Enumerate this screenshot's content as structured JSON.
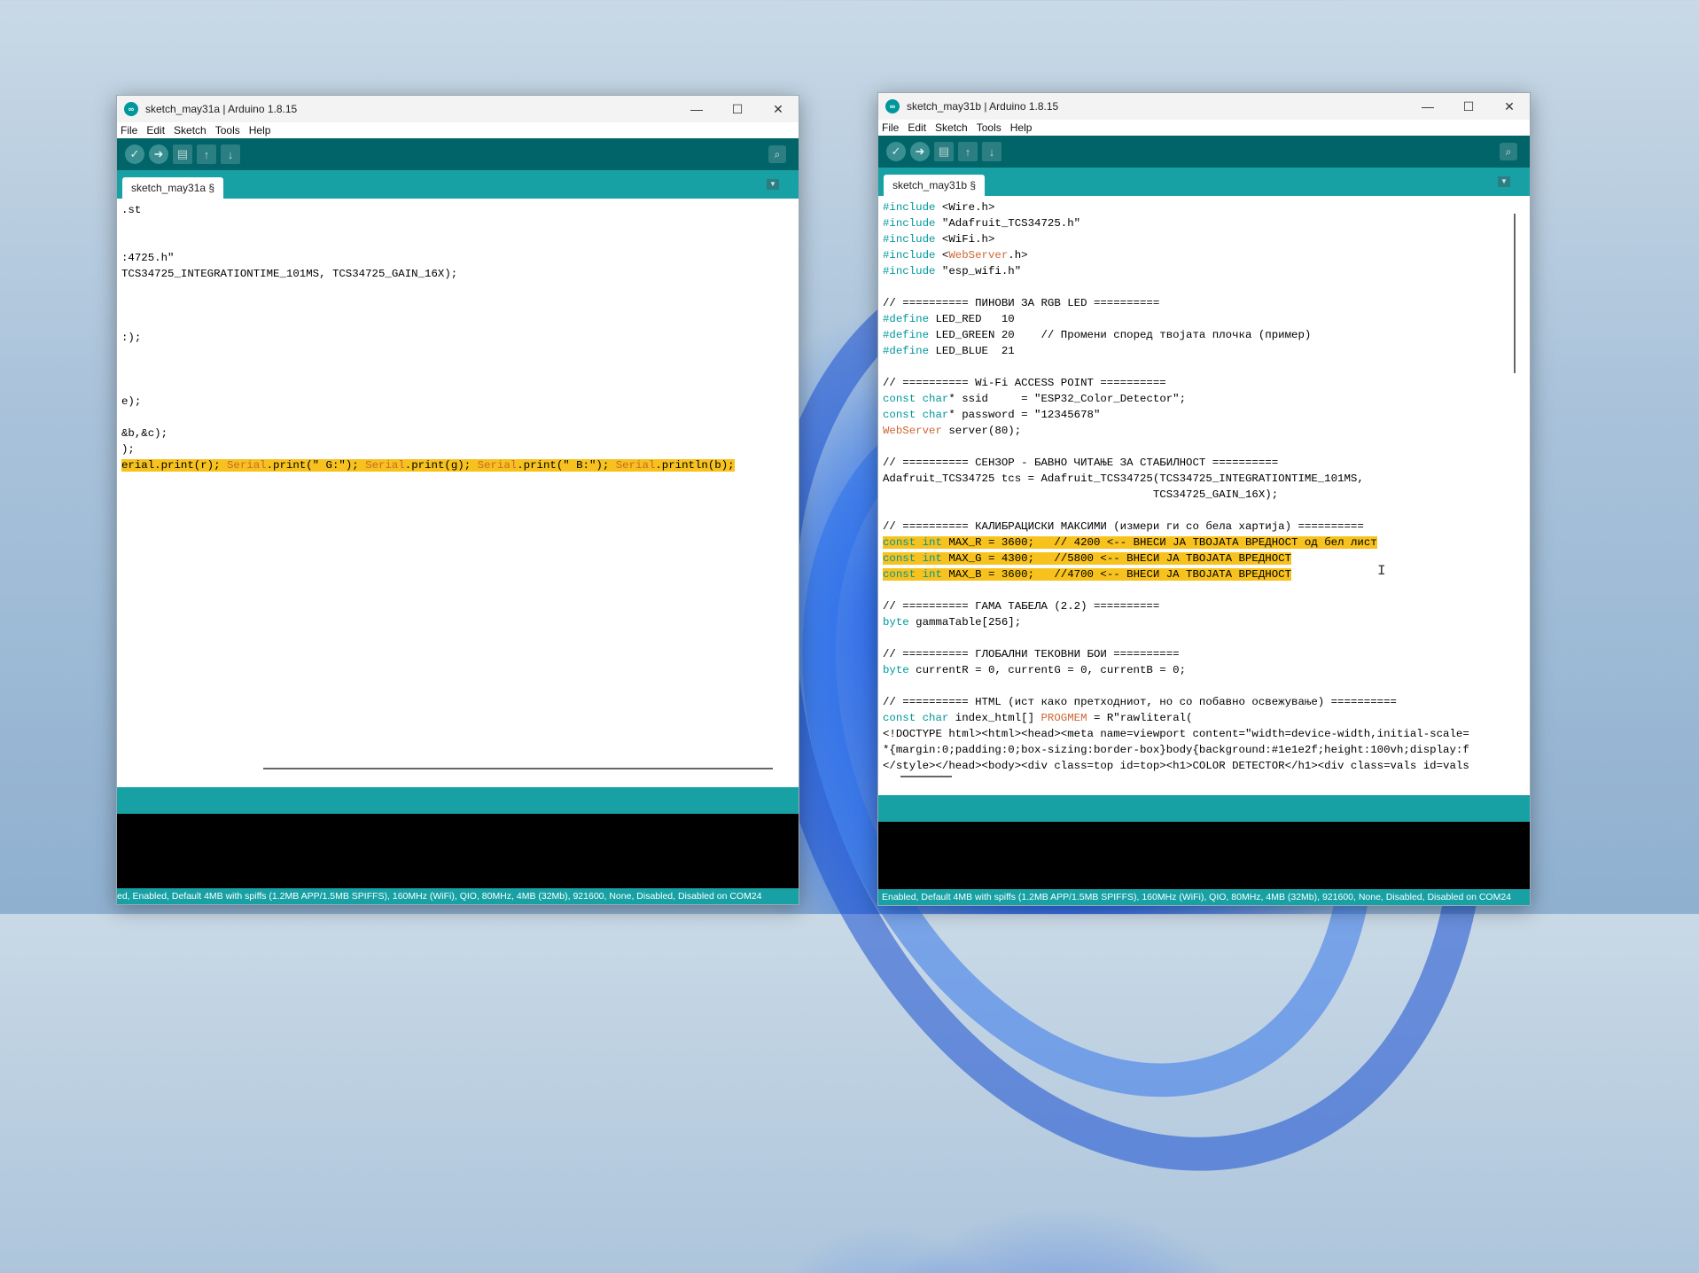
{
  "left": {
    "title": "sketch_may31a | Arduino 1.8.15",
    "menu": [
      "File",
      "Edit",
      "Sketch",
      "Tools",
      "Help"
    ],
    "tab_label": "sketch_may31a §",
    "code": [
      ".st",
      "",
      "",
      ":4725.h\"",
      "TCS34725_INTEGRATIONTIME_101MS, TCS34725_GAIN_16X);",
      "",
      "",
      "",
      ":);",
      "",
      "",
      "",
      "e);",
      "",
      "&b,&c);",
      ");",
      "erial.print(r); Serial.print(\" G:\"); Serial.print(g); Serial.print(\" B:\"); Serial.println(b);"
    ],
    "status": "ed, Enabled, Default 4MB with spiffs (1.2MB APP/1.5MB SPIFFS), 160MHz (WiFi), QIO, 80MHz, 4MB (32Mb), 921600, None, Disabled, Disabled on COM24"
  },
  "right": {
    "title": "sketch_may31b | Arduino 1.8.15",
    "menu": [
      "File",
      "Edit",
      "Sketch",
      "Tools",
      "Help"
    ],
    "tab_label": "sketch_may31b §",
    "code": [
      "#include <Wire.h>",
      "#include \"Adafruit_TCS34725.h\"",
      "#include <WiFi.h>",
      "#include <WebServer.h>",
      "#include \"esp_wifi.h\"",
      "",
      "// ========== ПИНОВИ ЗА RGB LED ==========",
      "#define LED_RED   10",
      "#define LED_GREEN 20    // Промени според твојата плочка (пример)",
      "#define LED_BLUE  21",
      "",
      "// ========== Wi-Fi ACCESS POINT ==========",
      "const char* ssid     = \"ESP32_Color_Detector\";",
      "const char* password = \"12345678\"",
      "WebServer server(80);",
      "",
      "// ========== СЕНЗОР - БАВНО ЧИТАЊЕ ЗА СТАБИЛНОСТ ==========",
      "Adafruit_TCS34725 tcs = Adafruit_TCS34725(TCS34725_INTEGRATIONTIME_101MS,",
      "                                         TCS34725_GAIN_16X);",
      "",
      "// ========== КАЛИБРАЦИСКИ МАКСИМИ (измери ги со бела хартија) ==========",
      "const int MAX_R = 3600;   // 4200 <-- ВНЕСИ ЈА ТВОЈАТА ВРЕДНОСТ од бел лист",
      "const int MAX_G = 4300;   //5800 <-- ВНЕСИ ЈА ТВОЈАТА ВРЕДНОСТ",
      "const int MAX_B = 3600;   //4700 <-- ВНЕСИ ЈА ТВОЈАТА ВРЕДНОСТ",
      "",
      "// ========== ГАМА ТАБЕЛА (2.2) ==========",
      "byte gammaTable[256];",
      "",
      "// ========== ГЛОБАЛНИ ТЕКОВНИ БОИ ==========",
      "byte currentR = 0, currentG = 0, currentB = 0;",
      "",
      "// ========== HTML (ист како претходниот, но со побавно освежување) ==========",
      "const char index_html[] PROGMEM = R\"rawliteral(",
      "<!DOCTYPE html><html><head><meta name=viewport content=\"width=device-width,initial-scale=",
      "*{margin:0;padding:0;box-sizing:border-box}body{background:#1e1e2f;height:100vh;display:f",
      "</style></head><body><div class=top id=top><h1>COLOR DETECTOR</h1><div class=vals id=vals"
    ],
    "status": "Enabled, Default 4MB with spiffs (1.2MB APP/1.5MB SPIFFS), 160MHz (WiFi), QIO, 80MHz, 4MB (32Mb), 921600, None, Disabled, Disabled on COM24"
  },
  "colors": {
    "toolbar": "#006468",
    "tabbar": "#17a1a5",
    "highlight": "#f7c21d",
    "keyword": "#00979c"
  }
}
